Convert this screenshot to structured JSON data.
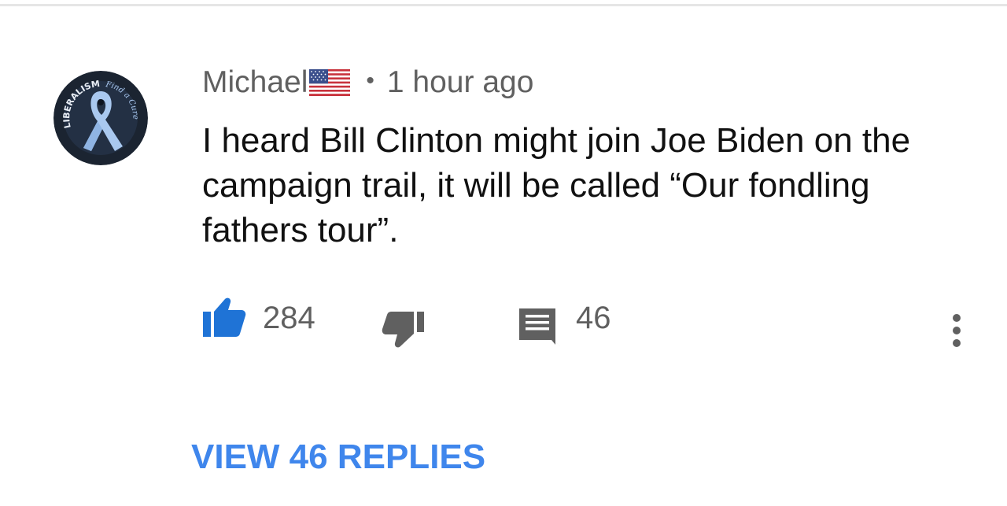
{
  "comment": {
    "author": "Michael",
    "author_flag_icon": "us-flag-icon",
    "separator": "•",
    "timestamp": "1 hour ago",
    "text": "I heard Bill Clinton might join Joe Biden on the campaign trail, it will be called “Our fondling fathers tour”.",
    "avatar": {
      "icon": "awareness-ribbon-avatar",
      "ring_text": "LIBERALISM",
      "script_text": "Find a Cure"
    }
  },
  "actions": {
    "like_icon": "thumbs-up-icon",
    "like_count": "284",
    "dislike_icon": "thumbs-down-icon",
    "reply_icon": "comment-icon",
    "reply_count": "46",
    "more_icon": "more-vertical-icon"
  },
  "view_replies_label": "VIEW 46 REPLIES",
  "colors": {
    "accent": "#3f86ec",
    "like_blue": "#1f73d6",
    "icon_grey": "#606060",
    "text": "#111111"
  }
}
